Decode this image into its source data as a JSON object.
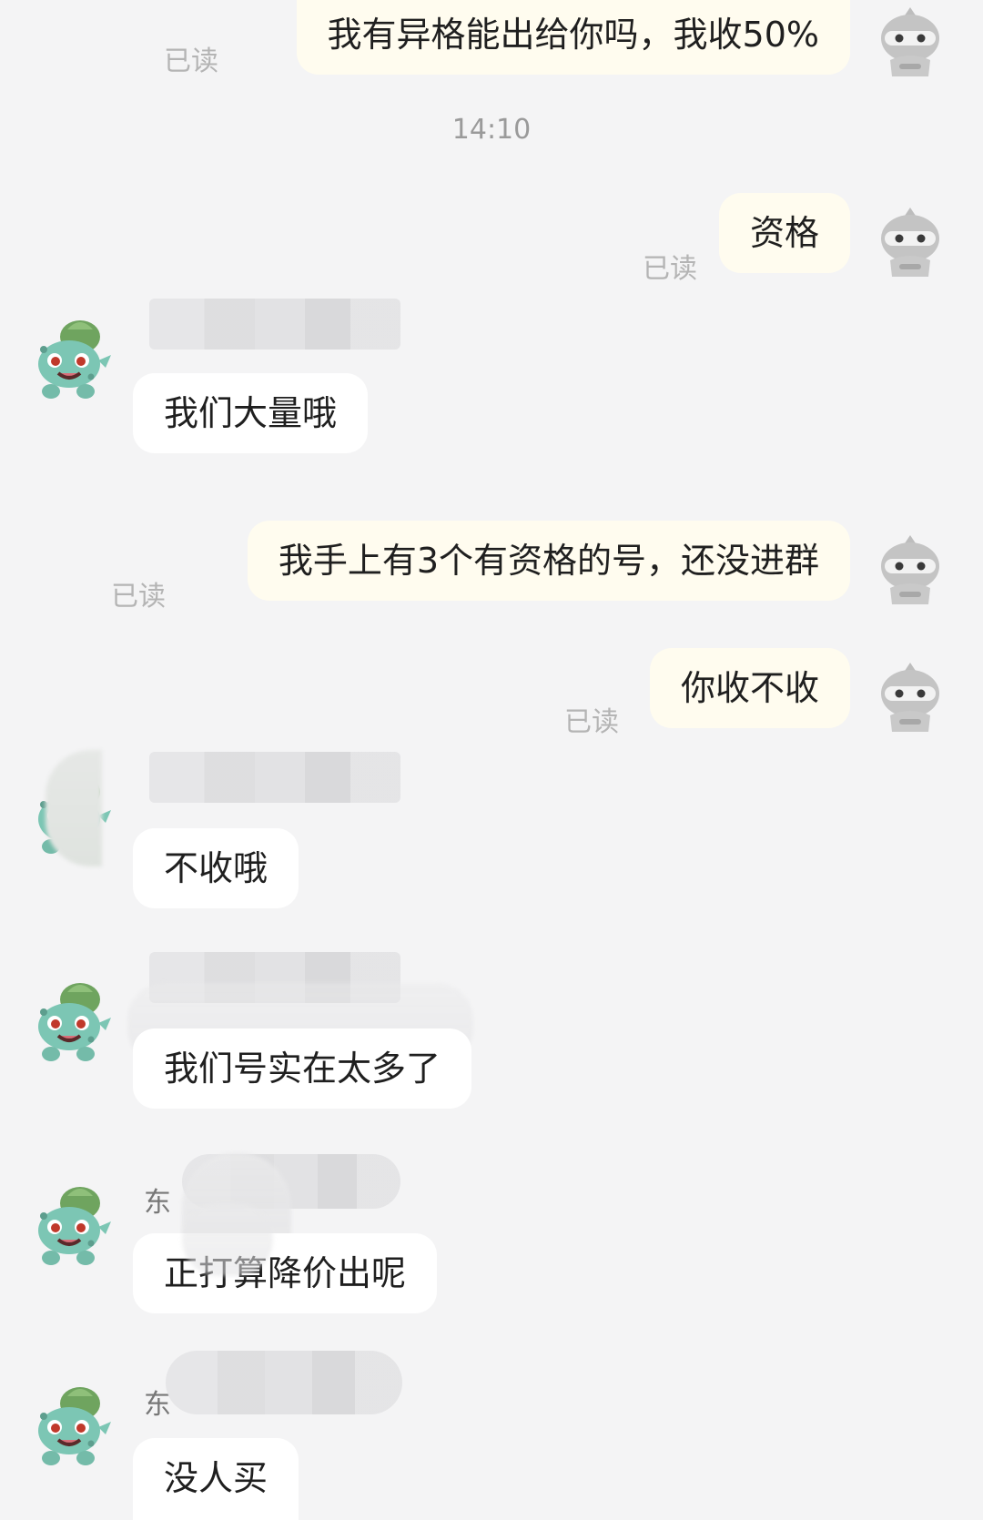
{
  "messages": {
    "m1": {
      "text": "我有异格能出给你吗，我收50%",
      "read": "已读"
    },
    "timestamp": "14:10",
    "m2": {
      "text": "资格",
      "read": "已读"
    },
    "m3": {
      "text": "我们大量哦"
    },
    "m4": {
      "text": "我手上有3个有资格的号，还没进群",
      "read": "已读"
    },
    "m5": {
      "text": "你收不收",
      "read": "已读"
    },
    "m6": {
      "text": "不收哦"
    },
    "m7": {
      "text": "我们号实在太多了"
    },
    "m8": {
      "text": "正打算降价出呢",
      "sender_initial": "东"
    },
    "m9": {
      "text": "没人买",
      "sender_initial": "东"
    }
  },
  "icons": {
    "my_avatar": "ninja-avatar-icon",
    "their_avatar": "bulbasaur-avatar-icon"
  },
  "colors": {
    "background": "#f4f4f5",
    "my_bubble": "#fffcef",
    "their_bubble": "#ffffff",
    "read_receipt": "#b4b4b4"
  }
}
